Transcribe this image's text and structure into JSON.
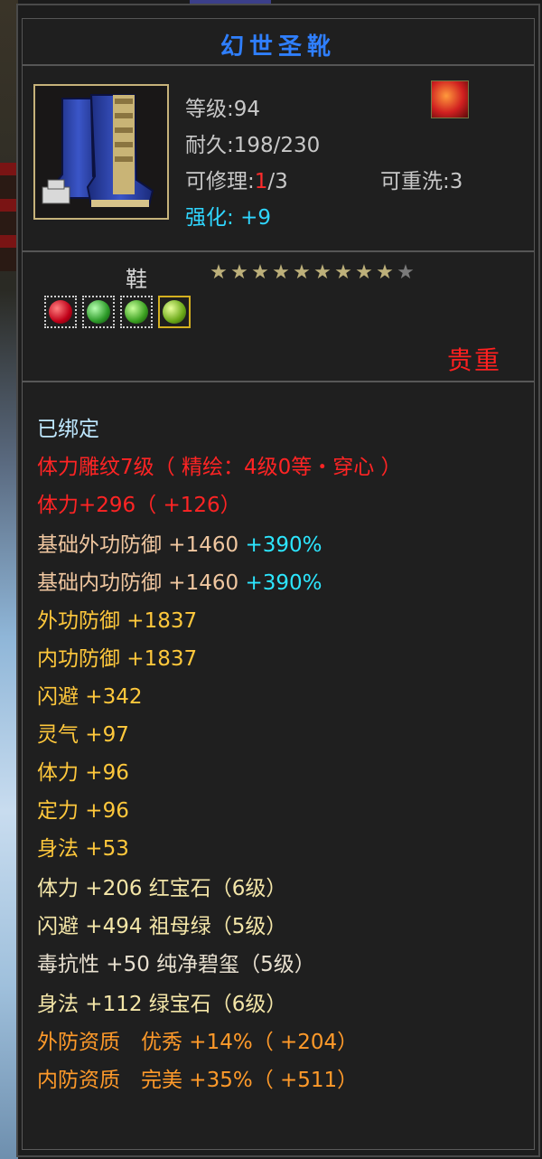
{
  "item": {
    "name": "幻世圣靴",
    "level": "等级:94",
    "durability": "耐久:198/230",
    "repair_label": "可修理:",
    "repair_used": "1",
    "repair_total": "/3",
    "rewash": "可重洗:3",
    "enhance_label": "强化:",
    "enhance_value": "+9",
    "slot": "鞋",
    "stars_filled": 9,
    "stars_total": 10,
    "rarity": "贵重",
    "icon": "boots-item-icon",
    "type_icon": "flame-badge-icon"
  },
  "gems": [
    {
      "name": "ruby-gem-icon",
      "color": "#c00018"
    },
    {
      "name": "emerald-gem-icon",
      "color": "#2c9a28"
    },
    {
      "name": "emerald-gem-icon",
      "color": "#3aa020"
    },
    {
      "name": "jade-gem-icon",
      "color": "#6aa818"
    }
  ],
  "stats": {
    "bound": "已绑定",
    "engrave": "体力雕纹7级（ 精绘：4级0等・穿心 ）",
    "vit_total": "体力+296（ +126）",
    "base_ext_def_label": "基础外功防御 +1460 ",
    "base_ext_def_pct": "+390%",
    "base_int_def_label": "基础内功防御 +1460 ",
    "base_int_def_pct": "+390%",
    "ext_def": "外功防御 +1837",
    "int_def": "内功防御 +1837",
    "dodge": "闪避 +342",
    "spirit": "灵气 +97",
    "vitality": "体力 +96",
    "focus": "定力 +96",
    "agility": "身法 +53",
    "gem_vit": "体力 +206 红宝石（6级）",
    "gem_dodge": "闪避 +494 祖母绿（5级）",
    "gem_poison": "毒抗性 +50 纯净碧玺（5级）",
    "gem_agility": "身法 +112 绿宝石（6级）",
    "ext_quality": "外防资质　优秀 +14%（ +204）",
    "int_quality": "内防资质　完美 +35%（ +511）"
  }
}
